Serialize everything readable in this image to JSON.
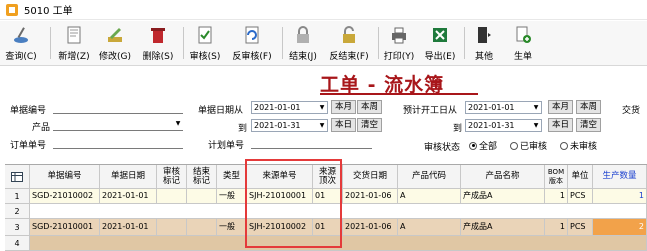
{
  "window": {
    "title": "5010 工单"
  },
  "toolbar": [
    {
      "label": "查询(C)",
      "icon": "query-icon"
    },
    {
      "label": "新增(Z)",
      "icon": "new-icon"
    },
    {
      "label": "修改(G)",
      "icon": "edit-icon"
    },
    {
      "label": "删除(S)",
      "icon": "delete-icon"
    },
    {
      "label": "审核(S)",
      "icon": "approve-icon"
    },
    {
      "label": "反审核(F)",
      "icon": "unapprove-icon"
    },
    {
      "label": "结束(J)",
      "icon": "lock-icon"
    },
    {
      "label": "反结束(F)",
      "icon": "unlock-icon"
    },
    {
      "label": "打印(Y)",
      "icon": "printer-icon"
    },
    {
      "label": "导出(E)",
      "icon": "excel-icon"
    },
    {
      "label": "其他",
      "icon": "other-icon"
    },
    {
      "label": "生单",
      "icon": "generate-icon"
    }
  ],
  "heading": "工单 - 流水簿",
  "form": {
    "doc_no_label": "单据编号",
    "product_label": "产品",
    "order_no_label": "订单单号",
    "doc_date_from_label": "单据日期从",
    "doc_date_from": "2021-01-01",
    "to_label": "到",
    "doc_date_to": "2021-01-31",
    "plan_no_label": "计划单号",
    "planned_start_from_label": "预计开工日从",
    "planned_start_from": "2021-01-01",
    "planned_start_to": "2021-01-31",
    "delivery_label": "交货",
    "btn_month": "本月",
    "btn_week": "本周",
    "btn_day": "本日",
    "btn_clear": "清空",
    "audit_label": "审核状态",
    "audit_options": [
      "全部",
      "已审核",
      "未审核"
    ]
  },
  "grid": {
    "headers": [
      "单据编号",
      "单据日期",
      "审核标记",
      "结束标记",
      "类型",
      "来源单号",
      "来源顶次",
      "交货日期",
      "产品代码",
      "产品名称",
      "BOM版本",
      "单位",
      "生产数量"
    ],
    "rows": [
      {
        "num": "1",
        "cells": [
          "SGD-21010002",
          "2021-01-01",
          "",
          "",
          "一般",
          "SJH-21010001",
          "01",
          "2021-01-06",
          "A",
          "产成品A",
          "1",
          "PCS",
          "1"
        ]
      },
      {
        "num": "2",
        "cells": [
          "",
          "",
          "",
          "",
          "",
          "",
          "",
          "",
          "",
          "",
          "",
          "",
          ""
        ]
      },
      {
        "num": "3",
        "cells": [
          "SGD-21010001",
          "2021-01-01",
          "",
          "",
          "一般",
          "SJH-21010002",
          "01",
          "2021-01-06",
          "A",
          "产成品A",
          "1",
          "PCS",
          "2"
        ]
      },
      {
        "num": "4",
        "cells": [
          "",
          "",
          "",
          "",
          "",
          "",
          "",
          "",
          "",
          "",
          "",
          "",
          ""
        ]
      }
    ]
  },
  "colors": {
    "heading": "#a8161a",
    "highlight_box": "#e43a3a",
    "row_odd": "#fdfbe6",
    "row_tan": "#ead4b8",
    "qty_header": "#1a3fcf"
  }
}
